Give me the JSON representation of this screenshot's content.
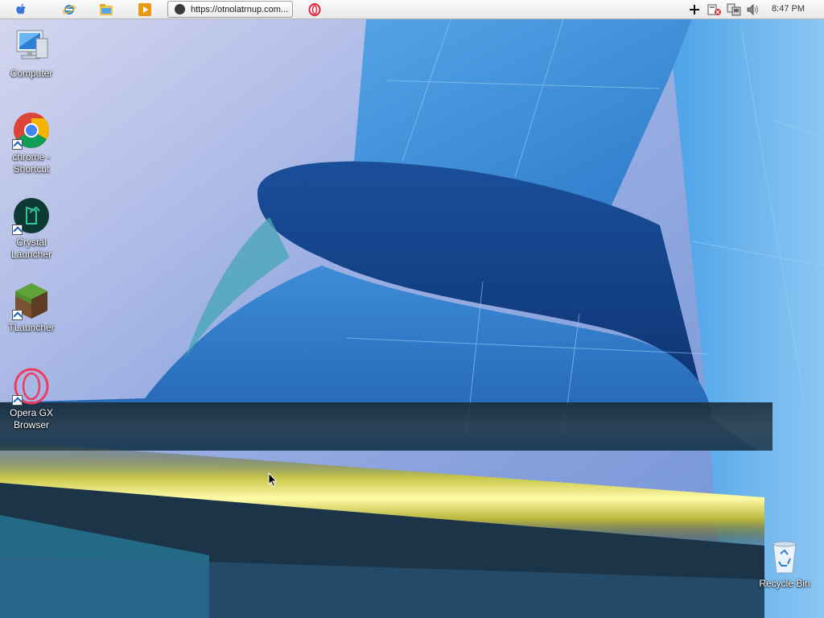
{
  "taskbar": {
    "tab": {
      "url": "https://otnolatrnup.com..."
    },
    "clock": "8:47 PM",
    "icons": [
      "apple-icon",
      "internet-explorer-icon",
      "file-explorer-icon",
      "media-player-icon",
      "opera-icon"
    ],
    "tray_icons": [
      "add-icon",
      "network-error-icon",
      "network-icon",
      "volume-icon"
    ]
  },
  "desktop_icons": [
    {
      "label": "Computer",
      "icon": "computer-icon"
    },
    {
      "label": "chrome - Shortcut",
      "icon": "chrome-icon"
    },
    {
      "label": "Crystal Launcher",
      "icon": "crystal-launcher-icon"
    },
    {
      "label": "TLauncher",
      "icon": "tlauncher-icon"
    },
    {
      "label": "Opera GX Browser",
      "icon": "opera-gx-icon"
    },
    {
      "label": "Recycle Bin",
      "icon": "recycle-bin-icon"
    }
  ],
  "colors": {
    "accent": "#1b5fb5",
    "wallpaper_blue": "#3b86d6",
    "yellow_streak": "#f3f16a"
  }
}
